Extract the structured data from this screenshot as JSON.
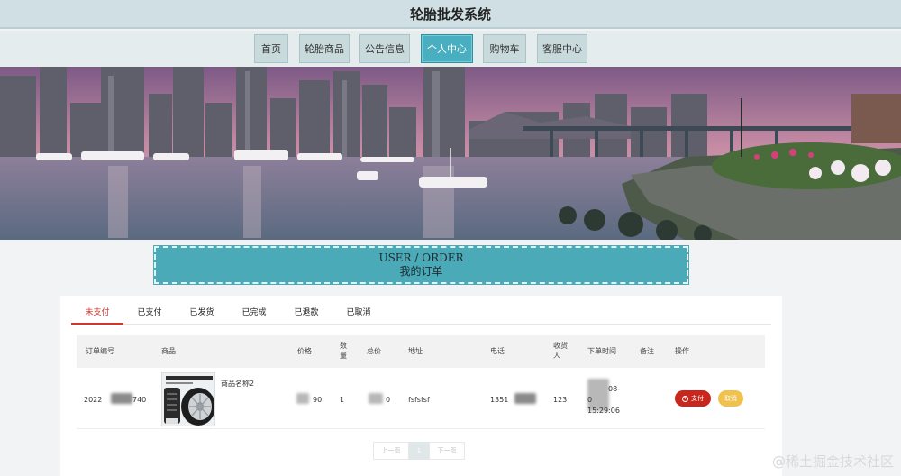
{
  "header": {
    "title": "轮胎批发系统"
  },
  "nav": {
    "items": [
      {
        "label": "首页"
      },
      {
        "label": "轮胎商品"
      },
      {
        "label": "公告信息"
      },
      {
        "label": "个人中心",
        "active": true
      },
      {
        "label": "购物车"
      },
      {
        "label": "客服中心"
      }
    ],
    "active_color": "#48afc0"
  },
  "section": {
    "title_en": "USER / ORDER",
    "title_zh": "我的订单"
  },
  "tabs": [
    {
      "label": "未支付",
      "active": true
    },
    {
      "label": "已支付"
    },
    {
      "label": "已发货"
    },
    {
      "label": "已完成"
    },
    {
      "label": "已退款"
    },
    {
      "label": "已取消"
    }
  ],
  "table": {
    "headers": {
      "order_no": "订单编号",
      "product": "商品",
      "price": "价格",
      "qty": "数量",
      "total": "总价",
      "address": "地址",
      "phone": "电话",
      "receiver": "收货人",
      "order_time": "下单时间",
      "remark": "备注",
      "action": "操作"
    },
    "rows": [
      {
        "order_no_start": "2022",
        "order_no_end": "740",
        "product_name": "商品名称2",
        "price_end": "90",
        "qty": "1",
        "total_end": "0",
        "address": "fsfsfsf",
        "phone_start": "1351",
        "receiver": "123",
        "time_end": "08-",
        "time_line2_start": "0",
        "time_line3": "15:29:06",
        "pay_label": "支付",
        "cancel_label": "取消"
      }
    ]
  },
  "pagination": {
    "prev": "上一页",
    "current": "1",
    "next": "下一页"
  },
  "watermark": "@稀土掘金技术社区"
}
